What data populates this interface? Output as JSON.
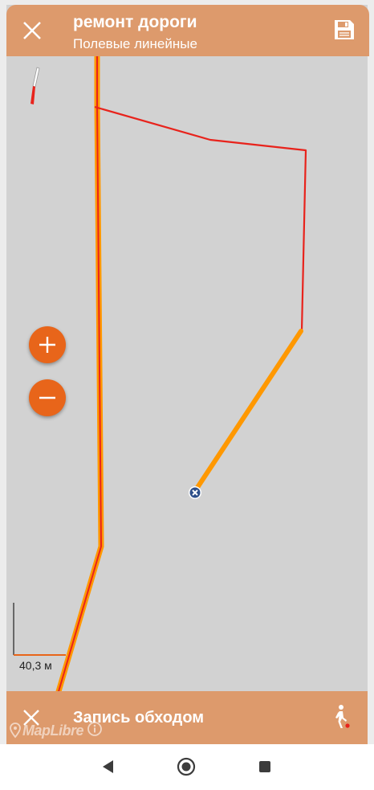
{
  "top_bar": {
    "title": "ремонт дороги",
    "subtitle": "Полевые линейные",
    "close_icon": "close-icon",
    "save_icon": "save-icon"
  },
  "map": {
    "compass_icon": "compass-icon",
    "zoom_in_icon": "plus-icon",
    "zoom_out_icon": "minus-icon",
    "scale_label": "40,3 м",
    "track_end_marker_icon": "close-circle-icon",
    "attribution": {
      "logo": "MapLibre",
      "info_icon": "info-icon"
    }
  },
  "bottom_bar": {
    "title": "Запись обходом",
    "close_icon": "close-icon",
    "walk_icon": "walking-person-icon"
  },
  "nav_bar": {
    "back_icon": "back-triangle-icon",
    "home_icon": "home-circle-icon",
    "recents_icon": "recents-square-icon"
  },
  "colors": {
    "header_bg": "#dd9a6c",
    "accent_orange": "#e8651a",
    "track_orange": "#ff9800",
    "route_red": "#e8231c",
    "map_bg": "#d2d2d2"
  }
}
